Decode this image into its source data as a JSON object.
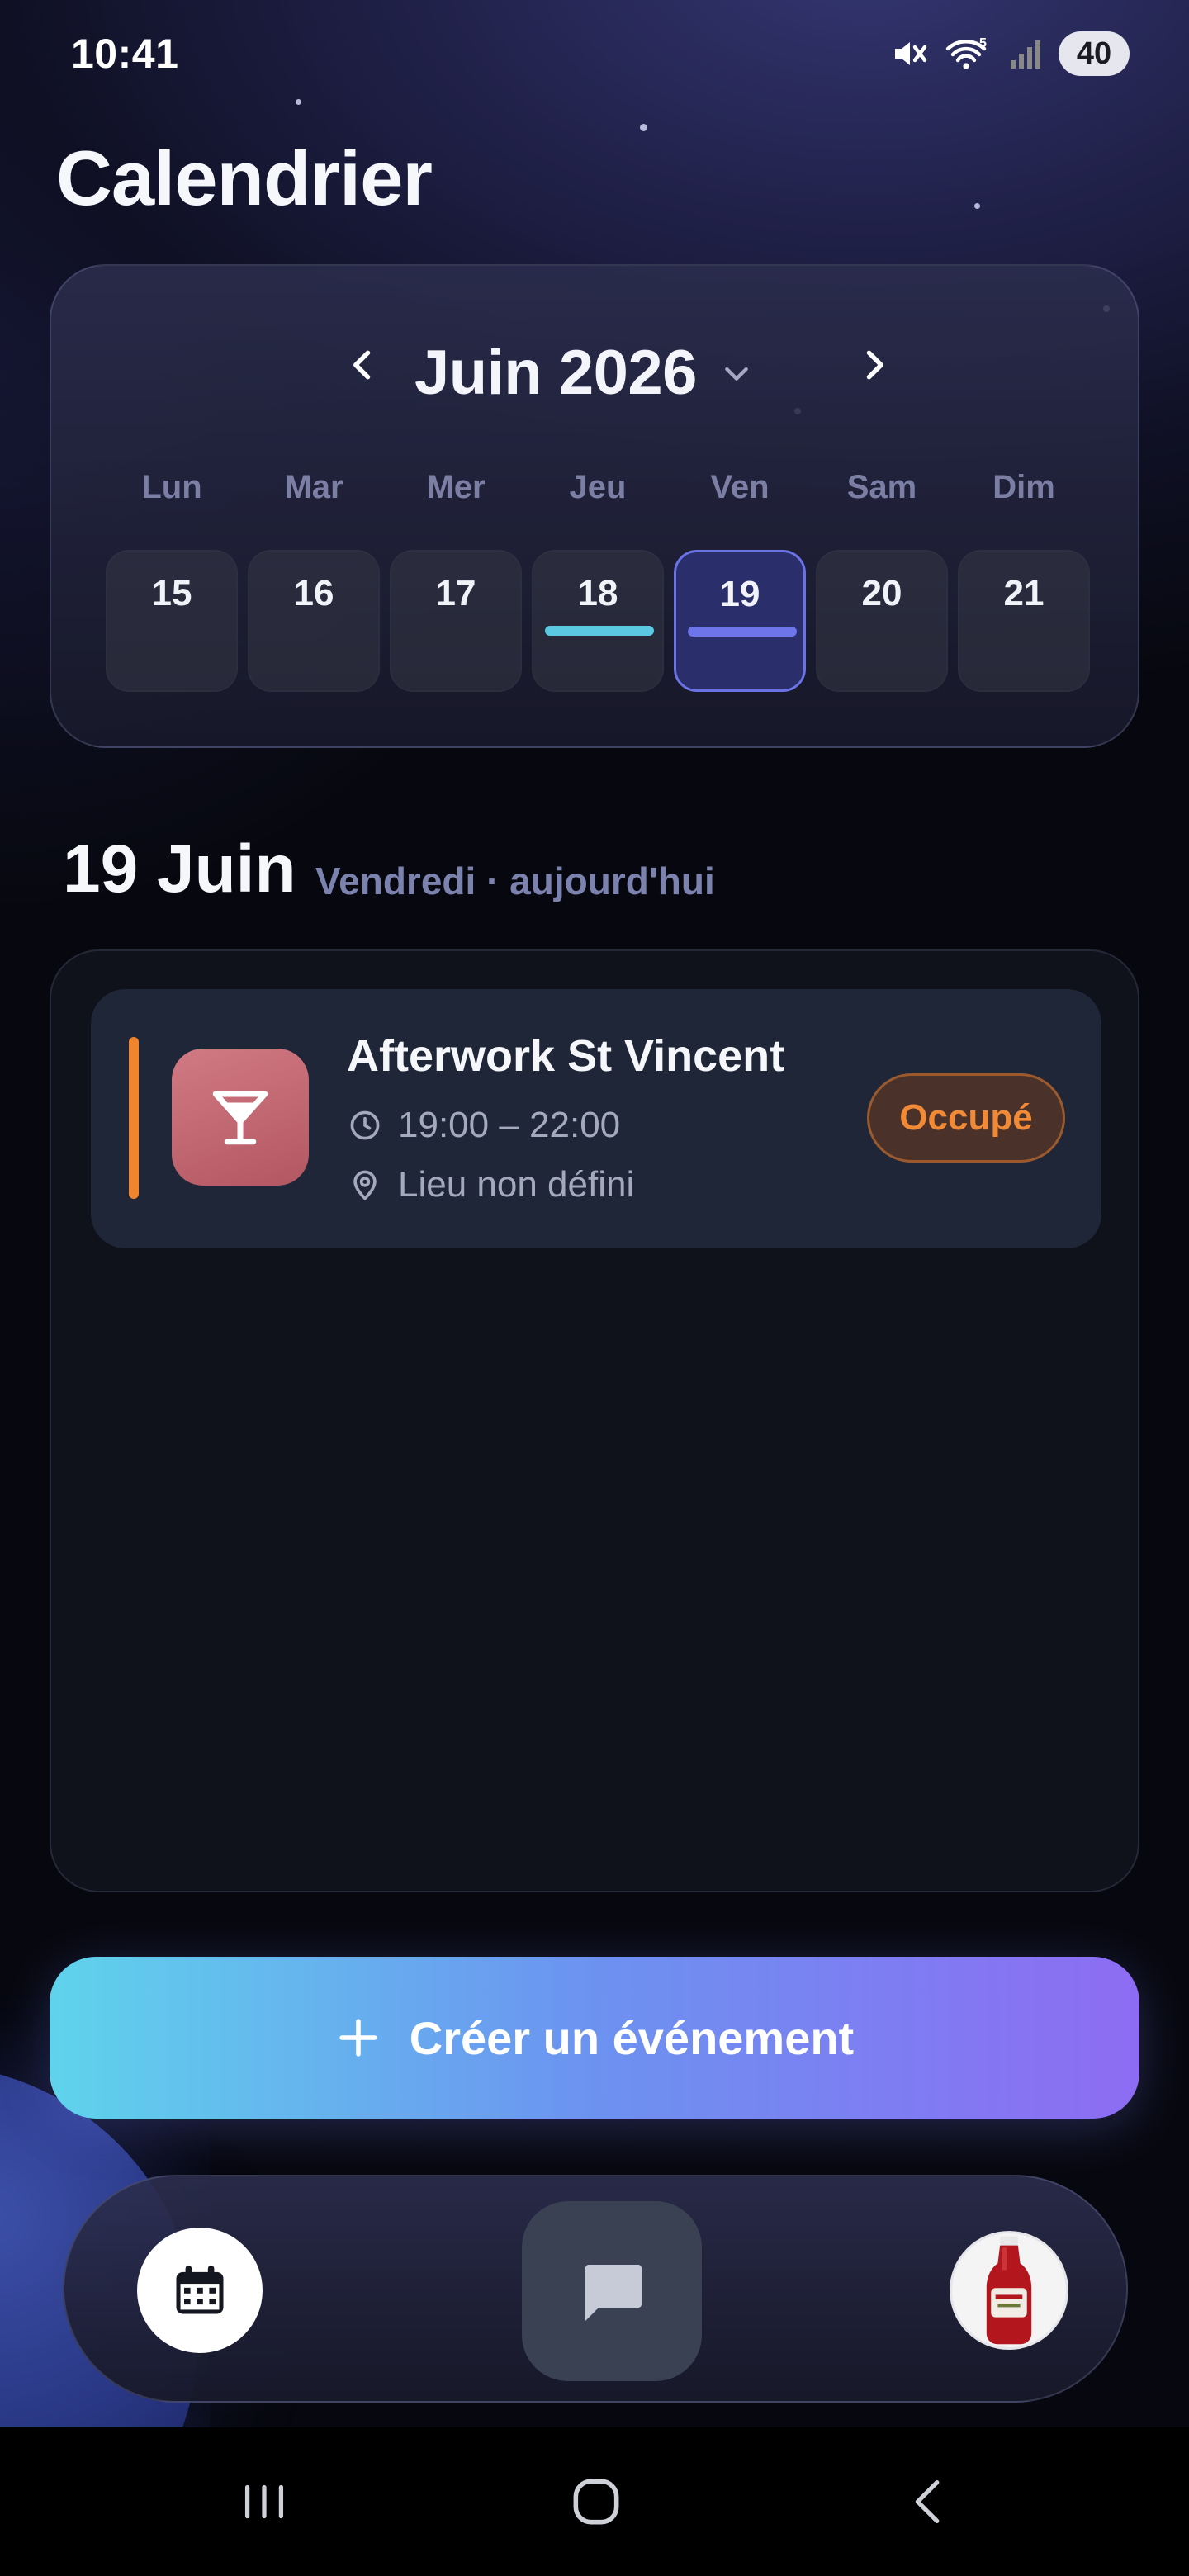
{
  "status_bar": {
    "time": "10:41",
    "battery": "40",
    "wifi_badge": "5",
    "icons": [
      "mute-icon",
      "wifi-icon",
      "signal-icon",
      "battery-icon"
    ]
  },
  "page_title": "Calendrier",
  "calendar": {
    "month_label": "Juin 2026",
    "weekdays": [
      "Lun",
      "Mar",
      "Mer",
      "Jeu",
      "Ven",
      "Sam",
      "Dim"
    ],
    "days": [
      {
        "num": "15",
        "marker": null,
        "selected": false
      },
      {
        "num": "16",
        "marker": null,
        "selected": false
      },
      {
        "num": "17",
        "marker": null,
        "selected": false
      },
      {
        "num": "18",
        "marker": "#5cc9e2",
        "selected": false
      },
      {
        "num": "19",
        "marker": "#6e74ea",
        "selected": true
      },
      {
        "num": "20",
        "marker": null,
        "selected": false
      },
      {
        "num": "21",
        "marker": null,
        "selected": false
      }
    ]
  },
  "selected_date": {
    "title": "19 Juin",
    "subtitle": "Vendredi · aujourd'hui"
  },
  "events": [
    {
      "title": "Afterwork St Vincent",
      "time": "19:00 – 22:00",
      "location": "Lieu non défini",
      "status": "Occupé",
      "accent_color": "#f1852e",
      "icon": "cocktail-icon"
    }
  ],
  "create_button": {
    "label": "Créer un événement"
  },
  "bottom_nav": {
    "items": [
      "calendar-icon",
      "chat-icon",
      "profile-avatar"
    ]
  },
  "system_nav": {
    "items": [
      "recent-apps-icon",
      "home-icon",
      "back-icon"
    ]
  },
  "colors": {
    "accent_gradient_start": "#5fd3ec",
    "accent_gradient_end": "#8d6cf3",
    "busy": "#f08a36",
    "selected_day": "#6a72e6"
  }
}
